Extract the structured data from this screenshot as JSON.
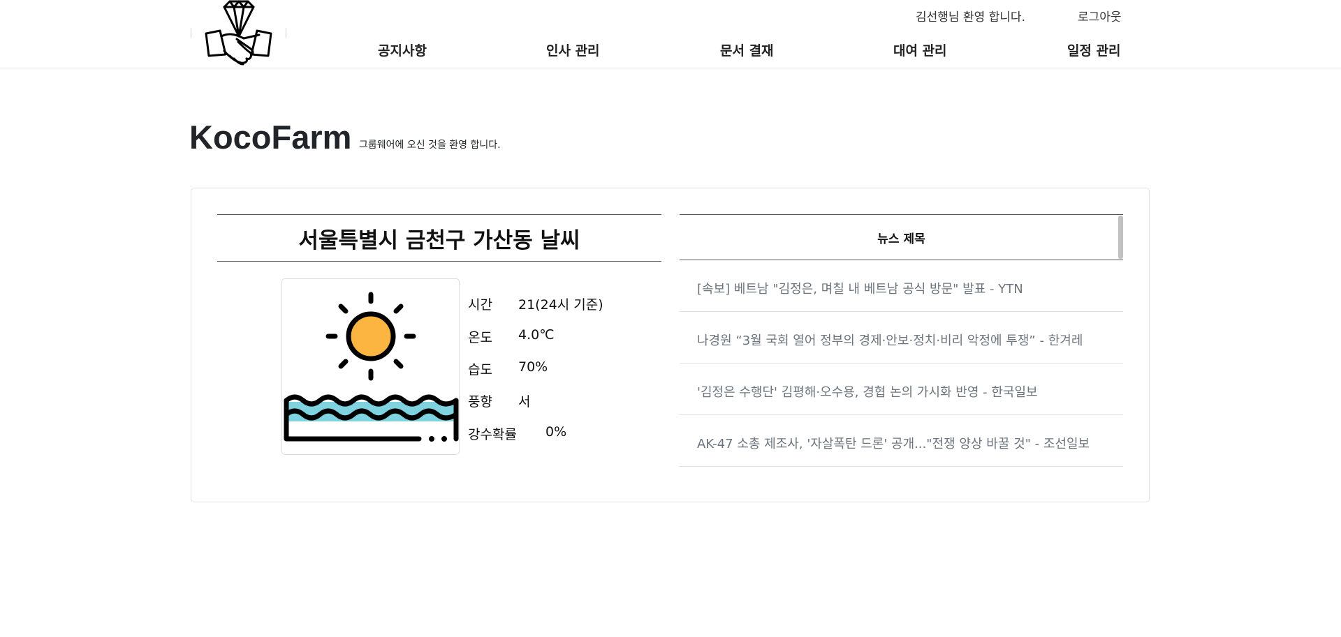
{
  "header": {
    "welcome_text": "김선행님 환영 합니다.",
    "logout_label": "로그아웃",
    "nav": [
      {
        "label": "공지사항"
      },
      {
        "label": "인사 관리"
      },
      {
        "label": "문서 결재"
      },
      {
        "label": "대여 관리"
      },
      {
        "label": "일정 관리"
      }
    ]
  },
  "page": {
    "title": "KocoFarm",
    "subtitle": "그룹웨어에 오신 것을 환영 합니다."
  },
  "weather": {
    "title": "서울특별시 금천구 가산동 날씨",
    "rows": [
      {
        "label": "시간",
        "value": "21(24시 기준)"
      },
      {
        "label": "온도",
        "value": "4.0℃"
      },
      {
        "label": "습도",
        "value": "70%"
      },
      {
        "label": "풍향",
        "value": "서"
      },
      {
        "label": "강수확률",
        "value": "0%"
      }
    ],
    "icon": "sun-over-sea-icon",
    "colors": {
      "sun": "#fcb541",
      "water": "#7fd3e0"
    }
  },
  "news": {
    "header": "뉴스 제목",
    "items": [
      {
        "title": "[속보] 베트남 \"김정은, 며칠 내 베트남 공식 방문\" 발표 - YTN"
      },
      {
        "title": "나경원 “3월 국회 열어 정부의 경제·안보·정치·비리 악정에 투쟁” - 한겨레"
      },
      {
        "title": "'김정은 수행단' 김평해·오수용, 경협 논의 가시화 반영 - 한국일보"
      },
      {
        "title": "AK-47 소총 제조사, '자살폭탄 드론' 공개...\"전쟁 양상 바꿀 것\" - 조선일보"
      }
    ]
  }
}
